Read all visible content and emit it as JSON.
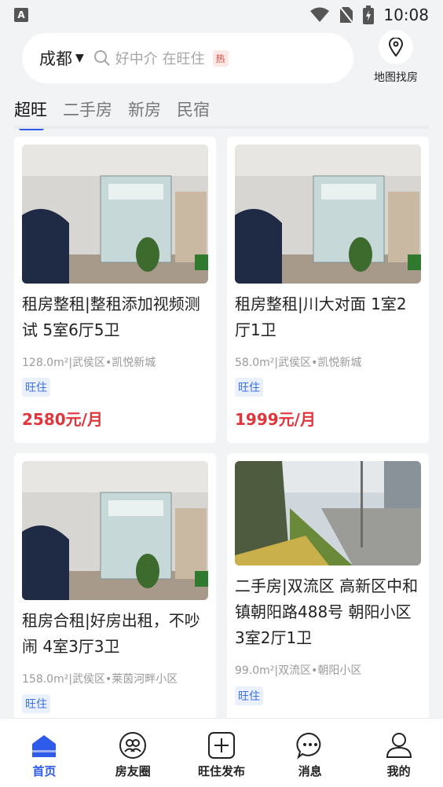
{
  "status_bar": {
    "time": "10:08",
    "app_icon_letter": "A"
  },
  "header": {
    "city": "成都",
    "search_placeholder": "好中介 在旺住",
    "hot_badge": "热",
    "map_label": "地图找房"
  },
  "tabs": [
    {
      "label": "超旺"
    },
    {
      "label": "二手房"
    },
    {
      "label": "新房"
    },
    {
      "label": "民宿"
    }
  ],
  "listings": [
    {
      "title": "租房整租|整租添加视频测试 5室6厅5卫",
      "meta": "128.0m²|武侯区•凯悦新城",
      "tag": "旺住",
      "price": "2580元/月"
    },
    {
      "title": "租房整租|川大对面 1室2厅1卫",
      "meta": "58.0m²|武侯区•凯悦新城",
      "tag": "旺住",
      "price": "1999元/月"
    },
    {
      "title": "租房合租|好房出租，不吵闹 4室3厅3卫",
      "meta": "158.0m²|武侯区•莱茵河畔小区",
      "tag": "旺住",
      "price": ""
    },
    {
      "title": "二手房|双流区 高新区中和镇朝阳路488号 朝阳小区 3室2厅1卫",
      "meta": "99.0m²|双流区•朝阳小区",
      "tag": "旺住",
      "price": ""
    }
  ],
  "bottom_nav": [
    {
      "label": "首页",
      "icon": "home-icon",
      "active": true
    },
    {
      "label": "房友圈",
      "icon": "friends-icon",
      "active": false
    },
    {
      "label": "旺住发布",
      "icon": "publish-icon",
      "active": false
    },
    {
      "label": "消息",
      "icon": "message-icon",
      "active": false
    },
    {
      "label": "我的",
      "icon": "profile-icon",
      "active": false
    }
  ],
  "colors": {
    "accent": "#2f5bea",
    "price": "#e0353a",
    "tag_bg": "#eaf1fd",
    "tag_text": "#3a70e6"
  }
}
